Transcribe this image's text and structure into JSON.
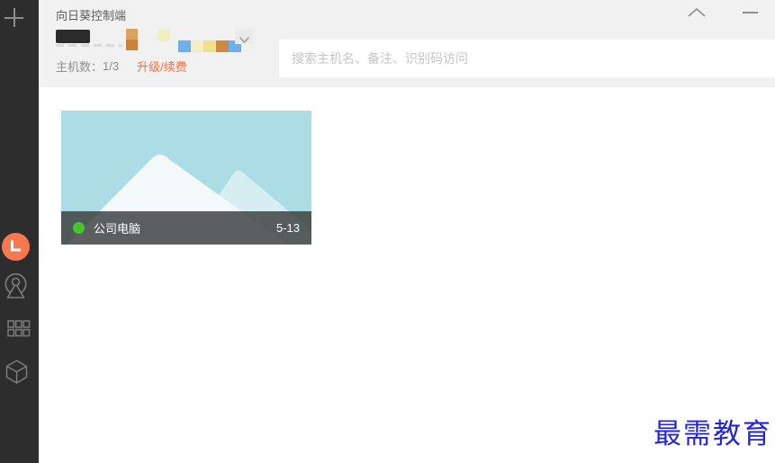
{
  "window": {
    "title": "向日葵控制端"
  },
  "account": {
    "host_count_label": "主机数：",
    "host_count_value": "1/3",
    "upgrade_link": "升级/续费",
    "badge_colors": [
      "#d9a45e",
      "#c9833d",
      "#f3edc2",
      "#6cb0f1",
      "#f2eec6",
      "#eee08e",
      "#cd8a3e",
      "#6cb0f1"
    ]
  },
  "search": {
    "placeholder": "搜索主机名、备注、识别码访问"
  },
  "hosts": [
    {
      "name": "公司电脑",
      "id_short": "5-13",
      "status": "online",
      "status_color": "#49c52c"
    }
  ],
  "watermark": {
    "text": "最需教育",
    "color": "#2424d8"
  },
  "colors": {
    "sidebar_bg": "#2d2d2d",
    "header_bg": "#f1f1f1",
    "accent_orange": "#f5713e",
    "avatar_orange": "#f8794f",
    "card_bg": "#addde4",
    "mountain_big": "#f4fafb",
    "mountain_small": "#d6edf2",
    "card_bar": "rgba(58,60,60,0.82)"
  }
}
